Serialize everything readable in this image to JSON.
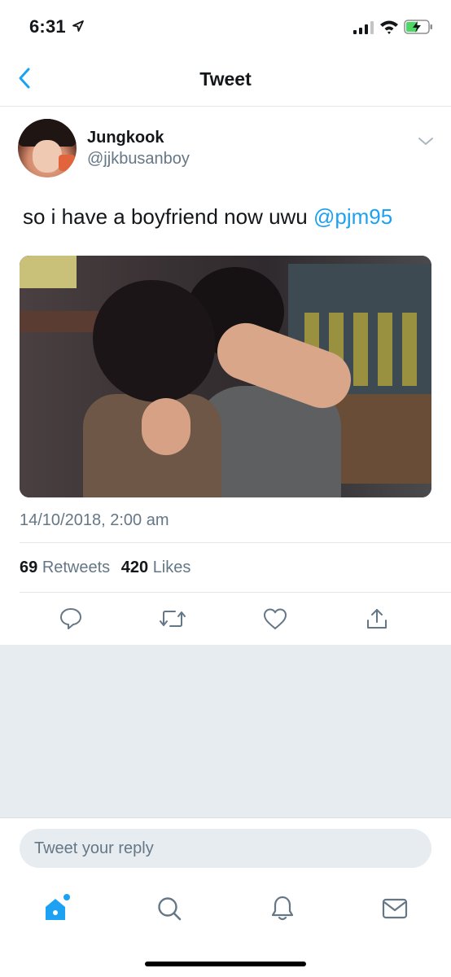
{
  "status_bar": {
    "time": "6:31",
    "icons": [
      "location-arrow-icon",
      "signal-icon",
      "wifi-icon",
      "battery-charging-icon"
    ]
  },
  "nav": {
    "title": "Tweet",
    "back_icon": "chevron-left-icon"
  },
  "tweet": {
    "display_name": "Jungkook",
    "handle": "@jjkbusanboy",
    "text": "so i have a boyfriend now uwu",
    "mention": "@pjm95",
    "timestamp": "14/10/2018, 2:00 am",
    "retweets_count": "69",
    "retweets_label": "Retweets",
    "likes_count": "420",
    "likes_label": "Likes"
  },
  "actions": [
    "reply-icon",
    "retweet-icon",
    "like-icon",
    "share-icon"
  ],
  "reply": {
    "placeholder": "Tweet your reply"
  },
  "tab_bar": {
    "items": [
      "home-icon",
      "search-icon",
      "notifications-icon",
      "messages-icon"
    ],
    "active": "home-icon"
  },
  "colors": {
    "accent": "#1da1f2",
    "text": "#14171a",
    "secondary": "#657786",
    "divider": "#e1e8ed",
    "background_gray": "#e6ecf0"
  }
}
